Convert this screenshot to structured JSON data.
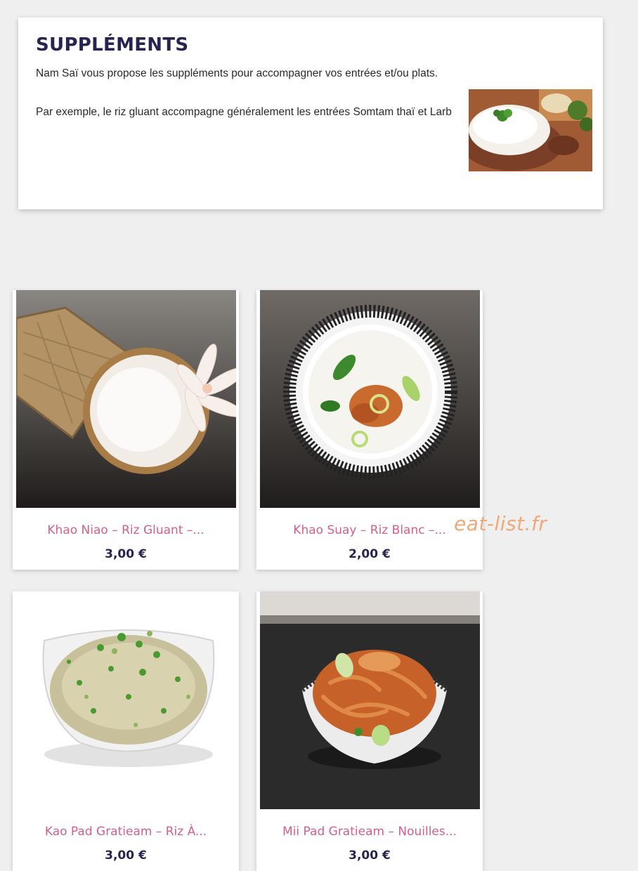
{
  "section": {
    "title": "SUPPLÉMENTS",
    "intro_line1": "Nam Saï vous propose les suppléments pour accompagner vos entrées et/ou plats.",
    "intro_line2": "Par exemple, le riz gluant accompagne généralement les entrées Somtam thaï et Larb"
  },
  "products": [
    {
      "name": "Khao Niao – Riz Gluant –...",
      "price": "3,00 €"
    },
    {
      "name": "Khao Suay – Riz Blanc –...",
      "price": "2,00 €"
    },
    {
      "name": "Kao Pad Gratieam – Riz À...",
      "price": "3,00 €"
    },
    {
      "name": "Mii Pad Gratieam – Nouilles...",
      "price": "3,00 €"
    }
  ],
  "watermark": "eat-list.fr"
}
